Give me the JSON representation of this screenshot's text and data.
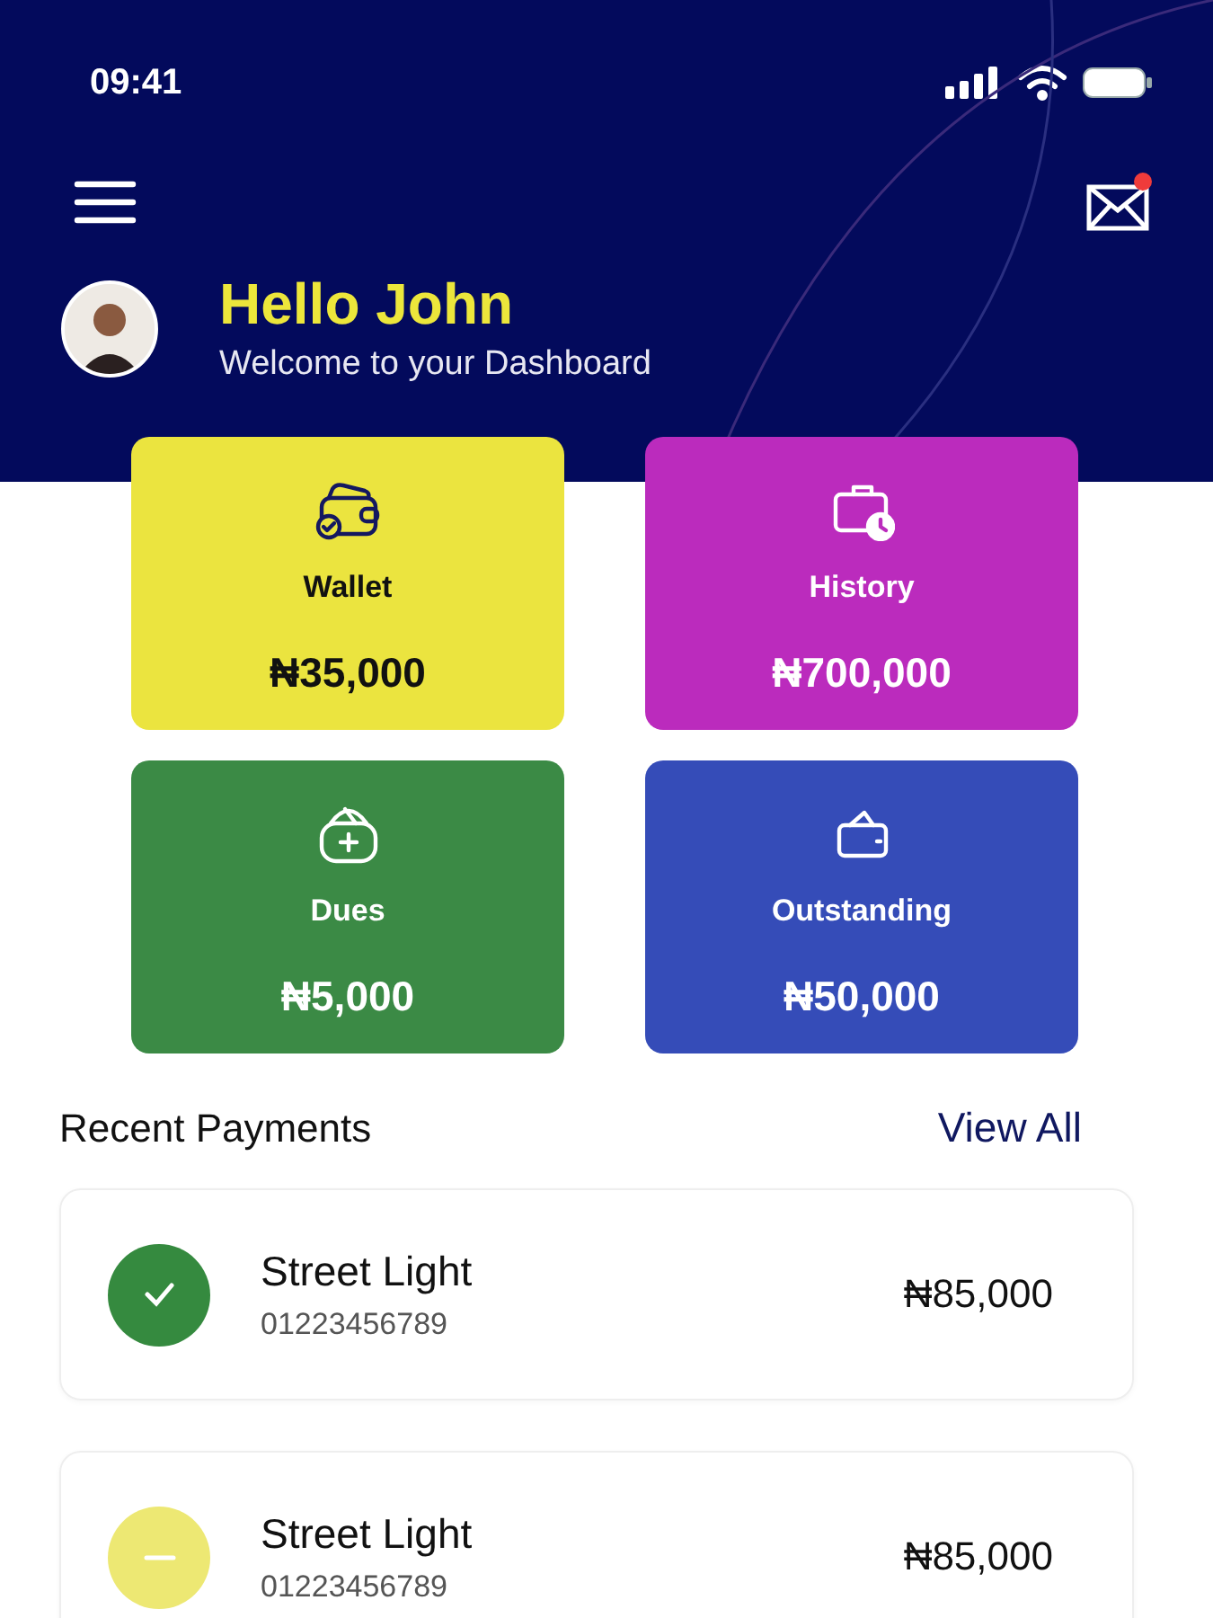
{
  "status_bar": {
    "time": "09:41"
  },
  "header": {
    "greeting": "Hello John",
    "subtitle": "Welcome to your Dashboard",
    "has_unread_mail": true
  },
  "tiles": [
    {
      "kind": "wallet",
      "label": "Wallet",
      "amount": "₦35,000",
      "color": "#ebe43f"
    },
    {
      "kind": "history",
      "label": "History",
      "amount": "₦700,000",
      "color": "#bb2bbd"
    },
    {
      "kind": "dues",
      "label": "Dues",
      "amount": "₦5,000",
      "color": "#3b8a45"
    },
    {
      "kind": "outstanding",
      "label": "Outstanding",
      "amount": "₦50,000",
      "color": "#354cb8"
    }
  ],
  "recent_payments": {
    "title": "Recent Payments",
    "link": "View All",
    "items": [
      {
        "kind": "paid",
        "name": "Street Light",
        "account": "01223456789",
        "amount": "₦85,000"
      },
      {
        "kind": "pending",
        "name": "Street Light",
        "account": "01223456789",
        "amount": "₦85,000"
      }
    ]
  }
}
